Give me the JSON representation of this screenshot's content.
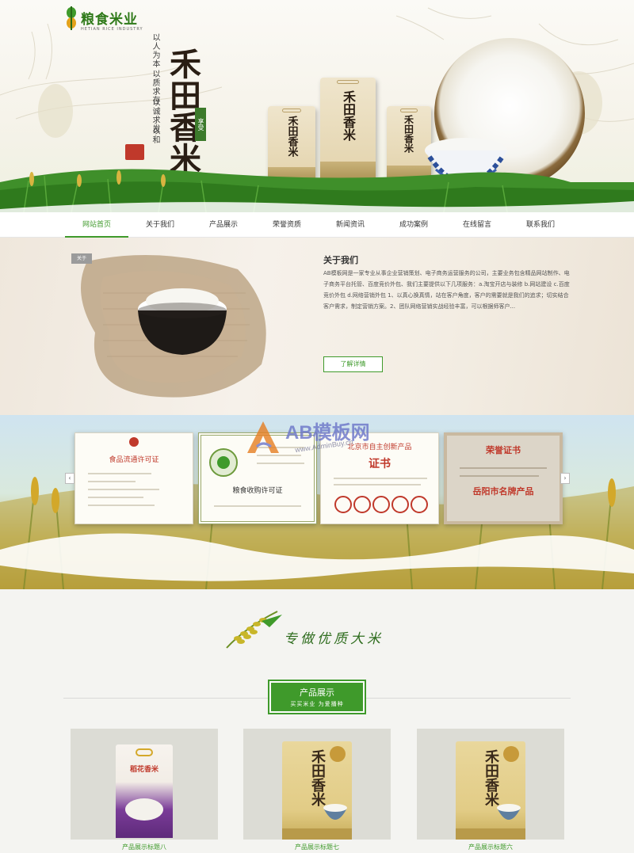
{
  "logo": {
    "name": "粮食米业",
    "subtitle": "HETIAN RICE INDUSTRY"
  },
  "hero": {
    "brand": "禾田香米",
    "slogans": [
      "以人为本",
      "以质求存",
      "以诚求发",
      "以和"
    ],
    "tag": "享受",
    "bag_names": [
      "禾田香米",
      "禾田香米",
      "禾田香米"
    ]
  },
  "nav": {
    "items": [
      {
        "label": "网站首页",
        "active": true
      },
      {
        "label": "关于我们",
        "active": false
      },
      {
        "label": "产品展示",
        "active": false
      },
      {
        "label": "荣誉资质",
        "active": false
      },
      {
        "label": "新闻资讯",
        "active": false
      },
      {
        "label": "成功案例",
        "active": false
      },
      {
        "label": "在线留言",
        "active": false
      },
      {
        "label": "联系我们",
        "active": false
      }
    ]
  },
  "about": {
    "tag": "关于",
    "title": "关于我们",
    "text": "AB模板网是一家专业从事企业营销策划、电子商务运营服务的公司，主要业务包含精品网站制作、电子商务平台托管、百度竞价外包、我们主要提供以下几项服务：a.淘宝开店与装修 b.网站建设 c.百度竞价外包 d.网络营销外包 1、以真心换真情，站在客户角度，客户的需要就是我们的追求；切实结合客户需求，制定营销方案。2、团队网络营销实战经验丰富，可以根据师客户...",
    "button": "了解详情"
  },
  "certificates": {
    "items": [
      {
        "title": "食品流通许可证",
        "big": ""
      },
      {
        "title": "粮食收购许可证",
        "big": ""
      },
      {
        "title": "北京市自主创新产品",
        "big": "证书"
      },
      {
        "title": "荣誉证书",
        "big": "岳阳市名牌产品"
      }
    ],
    "prev": "‹",
    "next": "›",
    "watermark": "AB模板网",
    "watermark_url": "www.AdminBuy.cn"
  },
  "products": {
    "calligraphy": "专做优质大米",
    "header_title": "产品展示",
    "header_subtitle": "买买米业  为爱播种",
    "items": [
      {
        "caption": "产品展示标题八",
        "pack_name": "稻花香米"
      },
      {
        "caption": "产品展示标题七",
        "pack_name": "禾田香米"
      },
      {
        "caption": "产品展示标题六",
        "pack_name": "禾田香米"
      }
    ]
  },
  "colors": {
    "primary_green": "#3f9a2b",
    "cert_red": "#c0392b"
  }
}
